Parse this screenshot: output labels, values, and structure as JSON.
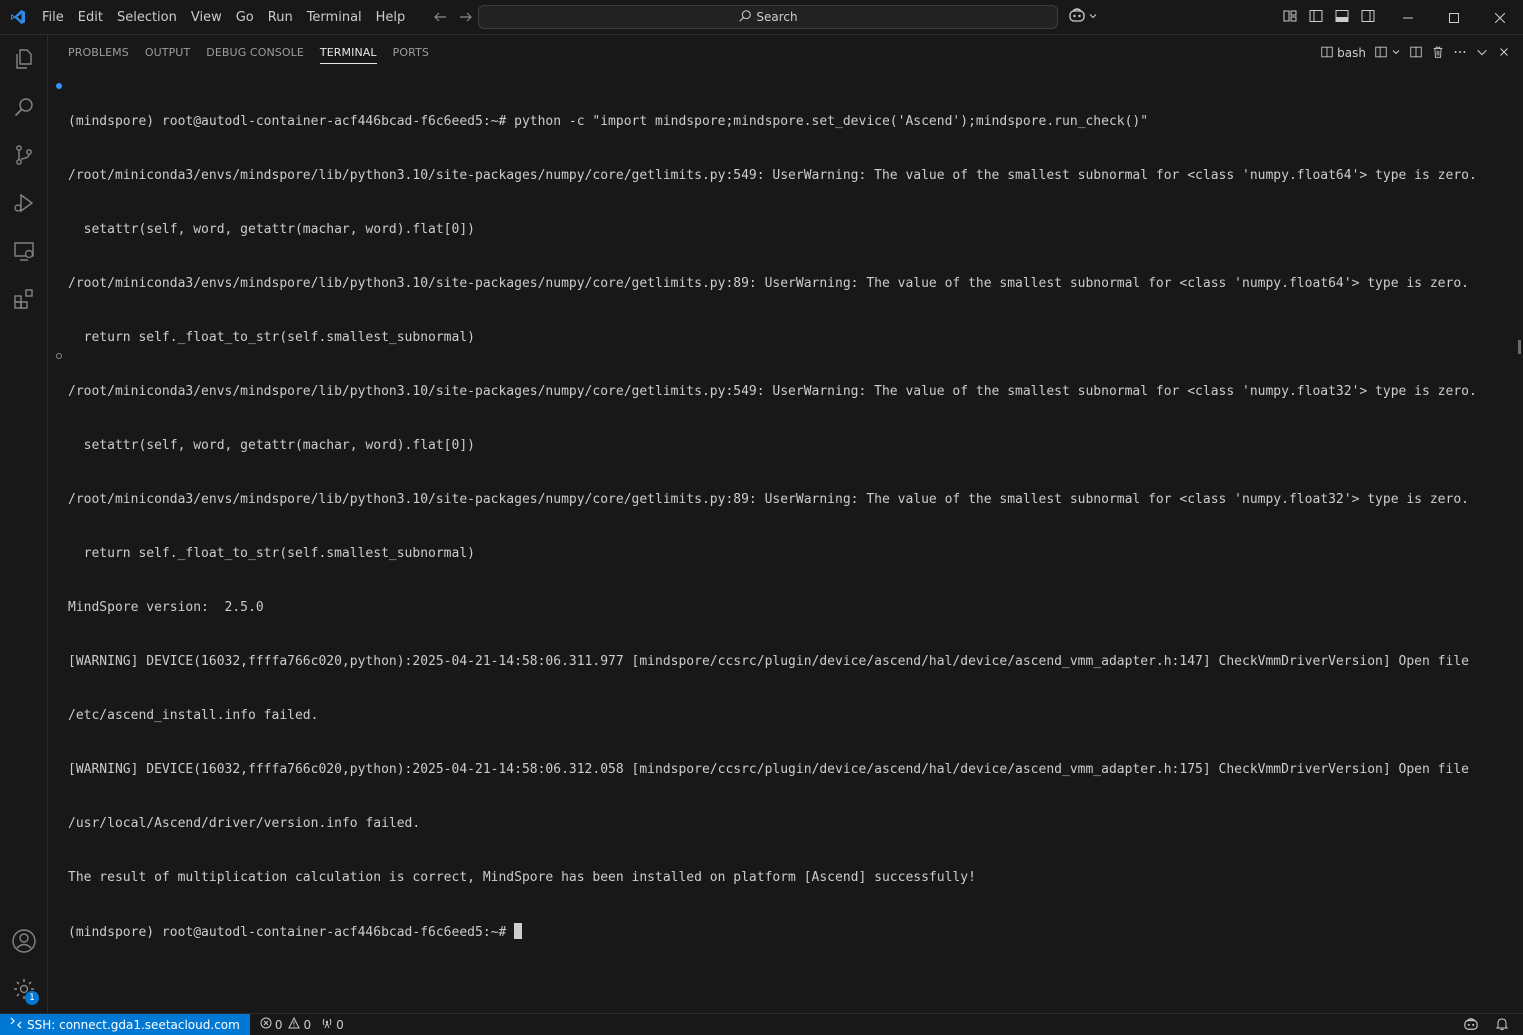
{
  "menu": [
    "File",
    "Edit",
    "Selection",
    "View",
    "Go",
    "Run",
    "Terminal",
    "Help"
  ],
  "search": {
    "label": "Search"
  },
  "panel": {
    "tabs": [
      "PROBLEMS",
      "OUTPUT",
      "DEBUG CONSOLE",
      "TERMINAL",
      "PORTS"
    ],
    "active_tab": "TERMINAL",
    "shell_label": "bash"
  },
  "terminal": {
    "lines": [
      "(mindspore) root@autodl-container-acf446bcad-f6c6eed5:~# python -c \"import mindspore;mindspore.set_device('Ascend');mindspore.run_check()\"",
      "/root/miniconda3/envs/mindspore/lib/python3.10/site-packages/numpy/core/getlimits.py:549: UserWarning: The value of the smallest subnormal for <class 'numpy.float64'> type is zero.",
      "  setattr(self, word, getattr(machar, word).flat[0])",
      "/root/miniconda3/envs/mindspore/lib/python3.10/site-packages/numpy/core/getlimits.py:89: UserWarning: The value of the smallest subnormal for <class 'numpy.float64'> type is zero.",
      "  return self._float_to_str(self.smallest_subnormal)",
      "/root/miniconda3/envs/mindspore/lib/python3.10/site-packages/numpy/core/getlimits.py:549: UserWarning: The value of the smallest subnormal for <class 'numpy.float32'> type is zero.",
      "  setattr(self, word, getattr(machar, word).flat[0])",
      "/root/miniconda3/envs/mindspore/lib/python3.10/site-packages/numpy/core/getlimits.py:89: UserWarning: The value of the smallest subnormal for <class 'numpy.float32'> type is zero.",
      "  return self._float_to_str(self.smallest_subnormal)",
      "MindSpore version:  2.5.0",
      "[WARNING] DEVICE(16032,ffffa766c020,python):2025-04-21-14:58:06.311.977 [mindspore/ccsrc/plugin/device/ascend/hal/device/ascend_vmm_adapter.h:147] CheckVmmDriverVersion] Open file",
      "/etc/ascend_install.info failed.",
      "[WARNING] DEVICE(16032,ffffa766c020,python):2025-04-21-14:58:06.312.058 [mindspore/ccsrc/plugin/device/ascend/hal/device/ascend_vmm_adapter.h:175] CheckVmmDriverVersion] Open file",
      "/usr/local/Ascend/driver/version.info failed.",
      "The result of multiplication calculation is correct, MindSpore has been installed on platform [Ascend] successfully!",
      "(mindspore) root@autodl-container-acf446bcad-f6c6eed5:~# "
    ]
  },
  "activity": {
    "settings_badge": "1"
  },
  "status": {
    "remote": "SSH: connect.gda1.seetacloud.com",
    "errors": "0",
    "warnings": "0",
    "ports": "0"
  },
  "colors": {
    "accent": "#0078d4",
    "background": "#181818",
    "decoration_blue": "#3794ff"
  }
}
